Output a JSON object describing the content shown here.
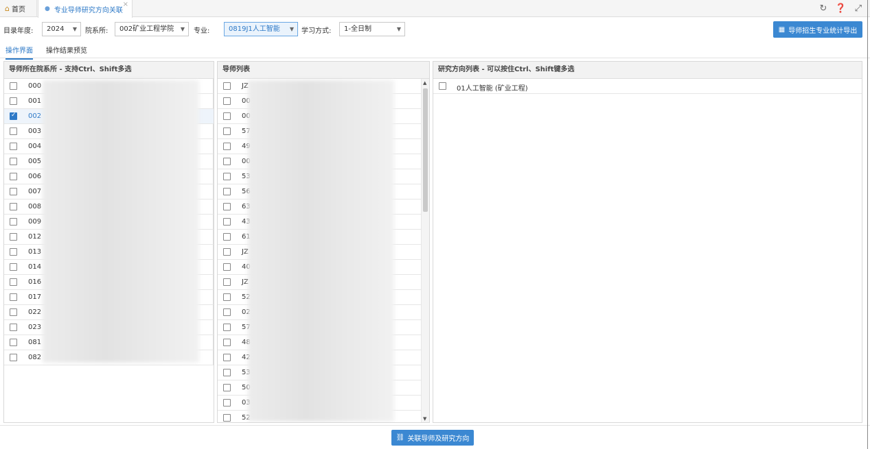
{
  "tabs": {
    "home": "首页",
    "active": "专业导师研究方向关联"
  },
  "filters": {
    "year_label": "目录年度:",
    "year_value": "2024",
    "dept_label": "院系所:",
    "dept_value": "002矿业工程学院",
    "major_label": "专业:",
    "major_value": "0819J1人工智能",
    "study_label": "学习方式:",
    "study_value": "1-全日制",
    "export_button": "导师招生专业统计导出"
  },
  "subtabs": {
    "operate": "操作界面",
    "preview": "操作结果预览"
  },
  "departments": {
    "header": "导师所在院系所 - 支持Ctrl、Shift多选",
    "items": [
      {
        "code": "000",
        "checked": false
      },
      {
        "code": "001",
        "checked": false
      },
      {
        "code": "002",
        "checked": true
      },
      {
        "code": "003",
        "checked": false
      },
      {
        "code": "004",
        "checked": false
      },
      {
        "code": "005",
        "checked": false
      },
      {
        "code": "006",
        "checked": false
      },
      {
        "code": "007",
        "checked": false
      },
      {
        "code": "008",
        "checked": false
      },
      {
        "code": "009",
        "checked": false
      },
      {
        "code": "012",
        "checked": false
      },
      {
        "code": "013",
        "checked": false
      },
      {
        "code": "014",
        "checked": false
      },
      {
        "code": "016",
        "checked": false
      },
      {
        "code": "017",
        "checked": false
      },
      {
        "code": "022",
        "checked": false
      },
      {
        "code": "023",
        "checked": false
      },
      {
        "code": "081",
        "checked": false
      },
      {
        "code": "082",
        "checked": false
      }
    ]
  },
  "tutors": {
    "header": "导师列表",
    "items": [
      "JZ",
      "00",
      "00",
      "57",
      "49",
      "00",
      "53",
      "56",
      "63",
      "43",
      "61",
      "JZ",
      "40",
      "JZ",
      "52",
      "02",
      "57",
      "48",
      "42",
      "53",
      "50",
      "03",
      "52"
    ]
  },
  "directions": {
    "header": "研究方向列表 - 可以按住Ctrl、Shift键多选",
    "items": [
      "01人工智能 (矿业工程)"
    ]
  },
  "bottom": {
    "link_button": "关联导师及研究方向"
  },
  "colors": {
    "accent": "#2d79c7",
    "button": "#3b88d2"
  }
}
